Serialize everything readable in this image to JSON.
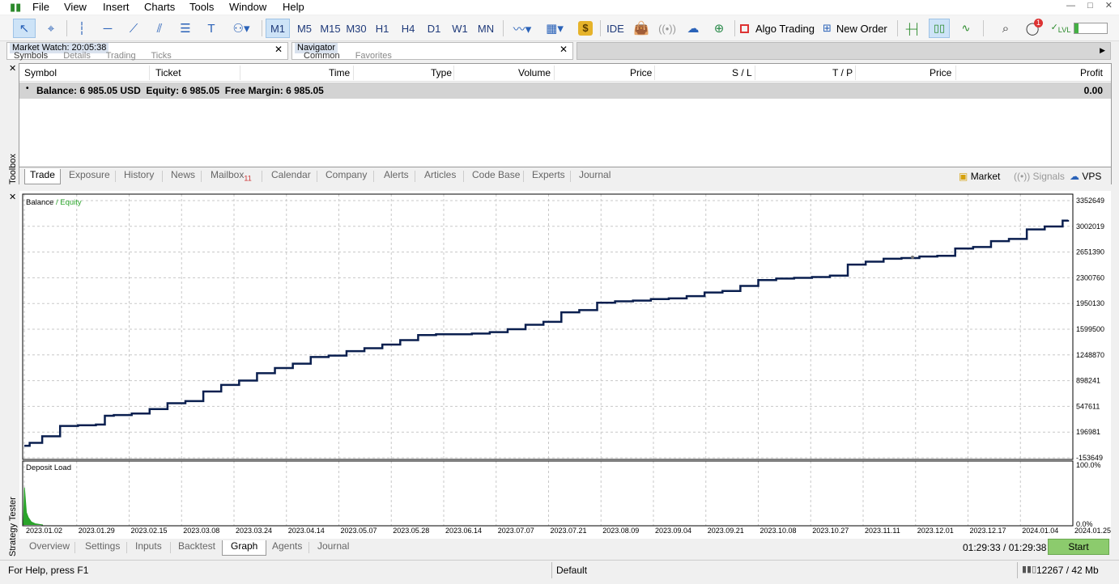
{
  "menu": [
    "File",
    "View",
    "Insert",
    "Charts",
    "Tools",
    "Window",
    "Help"
  ],
  "window_controls": [
    "—",
    "□",
    "✕"
  ],
  "timeframes": [
    "M1",
    "M5",
    "M15",
    "M30",
    "H1",
    "H4",
    "D1",
    "W1",
    "MN"
  ],
  "selected_timeframe": "M1",
  "toolbar": {
    "ide": "IDE",
    "algo_trading": "Algo Trading",
    "new_order": "New Order",
    "notification_count": "1"
  },
  "market_watch": {
    "title": "Market Watch: 20:05:38",
    "tabs": [
      "Symbols",
      "Details",
      "Trading",
      "Ticks"
    ]
  },
  "navigator": {
    "title": "Navigator",
    "tabs": [
      "Common",
      "Favorites"
    ]
  },
  "trade_table": {
    "columns": [
      "Symbol",
      "Ticket",
      "Time",
      "Type",
      "Volume",
      "Price",
      "S / L",
      "T / P",
      "Price",
      "Profit"
    ],
    "balance_row": "Balance: 6 985.05 USD  Equity: 6 985.05  Free Margin: 6 985.05",
    "balance_profit": "0.00"
  },
  "toolbox": {
    "side_label": "Toolbox",
    "tabs": [
      "Trade",
      "Exposure",
      "History",
      "News",
      "Mailbox",
      "Calendar",
      "Company",
      "Alerts",
      "Articles",
      "Code Base",
      "Experts",
      "Journal"
    ],
    "active_tab": "Trade",
    "mailbox_count": "11",
    "right_items": [
      "Market",
      "Signals",
      "VPS"
    ]
  },
  "chart_data": {
    "type": "line",
    "legend": [
      "Balance",
      "Equity"
    ],
    "y_ticks": [
      "3352649",
      "3002019",
      "2651390",
      "2300760",
      "1950130",
      "1599500",
      "1248870",
      "898241",
      "547611",
      "196981",
      "-153649"
    ],
    "ylim": [
      -153649,
      3352649
    ],
    "x_ticks": [
      "2023.01.02",
      "2023.01.29",
      "2023.02.15",
      "2023.03.08",
      "2023.03.24",
      "2023.04.14",
      "2023.05.07",
      "2023.05.28",
      "2023.06.14",
      "2023.07.07",
      "2023.07.21",
      "2023.08.09",
      "2023.09.04",
      "2023.09.21",
      "2023.10.08",
      "2023.10.27",
      "2023.11.11",
      "2023.12.01",
      "2023.12.17",
      "2024.01.04",
      "2024.01.25"
    ],
    "balance": [
      [
        0,
        10000
      ],
      [
        0.3,
        50000
      ],
      [
        1,
        140000
      ],
      [
        2,
        280000
      ],
      [
        3,
        290000
      ],
      [
        4,
        300000
      ],
      [
        4.5,
        420000
      ],
      [
        5,
        430000
      ],
      [
        6,
        450000
      ],
      [
        7,
        510000
      ],
      [
        8,
        590000
      ],
      [
        9,
        620000
      ],
      [
        10,
        750000
      ],
      [
        11,
        840000
      ],
      [
        12,
        900000
      ],
      [
        13,
        1000000
      ],
      [
        14,
        1070000
      ],
      [
        15,
        1130000
      ],
      [
        16,
        1220000
      ],
      [
        17,
        1240000
      ],
      [
        18,
        1300000
      ],
      [
        19,
        1340000
      ],
      [
        20,
        1390000
      ],
      [
        21,
        1450000
      ],
      [
        22,
        1520000
      ],
      [
        23,
        1530000
      ],
      [
        24,
        1530000
      ],
      [
        25,
        1540000
      ],
      [
        26,
        1560000
      ],
      [
        27,
        1600000
      ],
      [
        28,
        1660000
      ],
      [
        29,
        1700000
      ],
      [
        30,
        1830000
      ],
      [
        31,
        1860000
      ],
      [
        32,
        1960000
      ],
      [
        33,
        1980000
      ],
      [
        34,
        1990000
      ],
      [
        35,
        2010000
      ],
      [
        36,
        2020000
      ],
      [
        37,
        2050000
      ],
      [
        38,
        2100000
      ],
      [
        39,
        2120000
      ],
      [
        40,
        2190000
      ],
      [
        41,
        2270000
      ],
      [
        42,
        2290000
      ],
      [
        43,
        2300000
      ],
      [
        44,
        2310000
      ],
      [
        45,
        2330000
      ],
      [
        46,
        2480000
      ],
      [
        47,
        2520000
      ],
      [
        48,
        2560000
      ],
      [
        49,
        2570000
      ],
      [
        50,
        2590000
      ],
      [
        51,
        2600000
      ],
      [
        52,
        2700000
      ],
      [
        53,
        2720000
      ],
      [
        54,
        2800000
      ],
      [
        55,
        2830000
      ],
      [
        56,
        2960000
      ],
      [
        57,
        3000000
      ],
      [
        57.5,
        3000000
      ],
      [
        58,
        3080000
      ],
      [
        58.3,
        3090000
      ]
    ],
    "deposit_load": {
      "title": "Deposit Load",
      "y_ticks": [
        "100.0%",
        "0.0%"
      ],
      "values": [
        [
          0,
          0.0
        ],
        [
          0.1,
          0.6
        ],
        [
          0.3,
          0.2
        ],
        [
          0.5,
          0.12
        ],
        [
          0.8,
          0.05
        ],
        [
          1.2,
          0.02
        ],
        [
          2,
          0.0
        ]
      ]
    }
  },
  "tester": {
    "side_label": "Strategy Tester",
    "tabs": [
      "Overview",
      "Settings",
      "Inputs",
      "Backtest",
      "Graph",
      "Agents",
      "Journal"
    ],
    "active_tab": "Graph",
    "time": "01:29:33 / 01:29:38",
    "start_label": "Start"
  },
  "status": {
    "help": "For Help, press F1",
    "profile": "Default",
    "memory": "12267 / 42 Mb"
  },
  "colors": {
    "balance_line": "#0a1f4f",
    "equity_label": "#2aa42a",
    "deposit_bar": "#2aa42a",
    "start_button": "#8ccb6d"
  }
}
